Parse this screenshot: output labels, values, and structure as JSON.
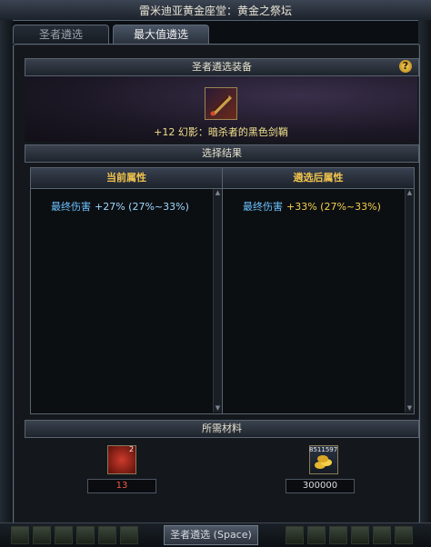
{
  "window": {
    "title": "雷米迪亚黄金座堂：黄金之祭坛"
  },
  "tabs": [
    {
      "label": "圣者遴选"
    },
    {
      "label": "最大值遴选"
    }
  ],
  "equip_section": {
    "header": "圣者遴选装备",
    "help_icon": "?",
    "item_name": "+12 幻影：暗杀者的黑色剑鞘"
  },
  "result_section": {
    "header": "选择结果"
  },
  "current_panel": {
    "header": "当前属性",
    "stat_label": "最终伤害",
    "stat_value": "+27% (27%~33%)"
  },
  "after_panel": {
    "header": "遴选后属性",
    "stat_label": "最终伤害",
    "stat_value": "+33% (27%~33%)"
  },
  "materials": {
    "header": "所需材料",
    "item1": {
      "badge": "2",
      "quantity": "13"
    },
    "item2": {
      "badge": "8511597",
      "quantity": "300000"
    }
  },
  "bottom": {
    "confirm_label": "圣者遴选 (Space)"
  }
}
